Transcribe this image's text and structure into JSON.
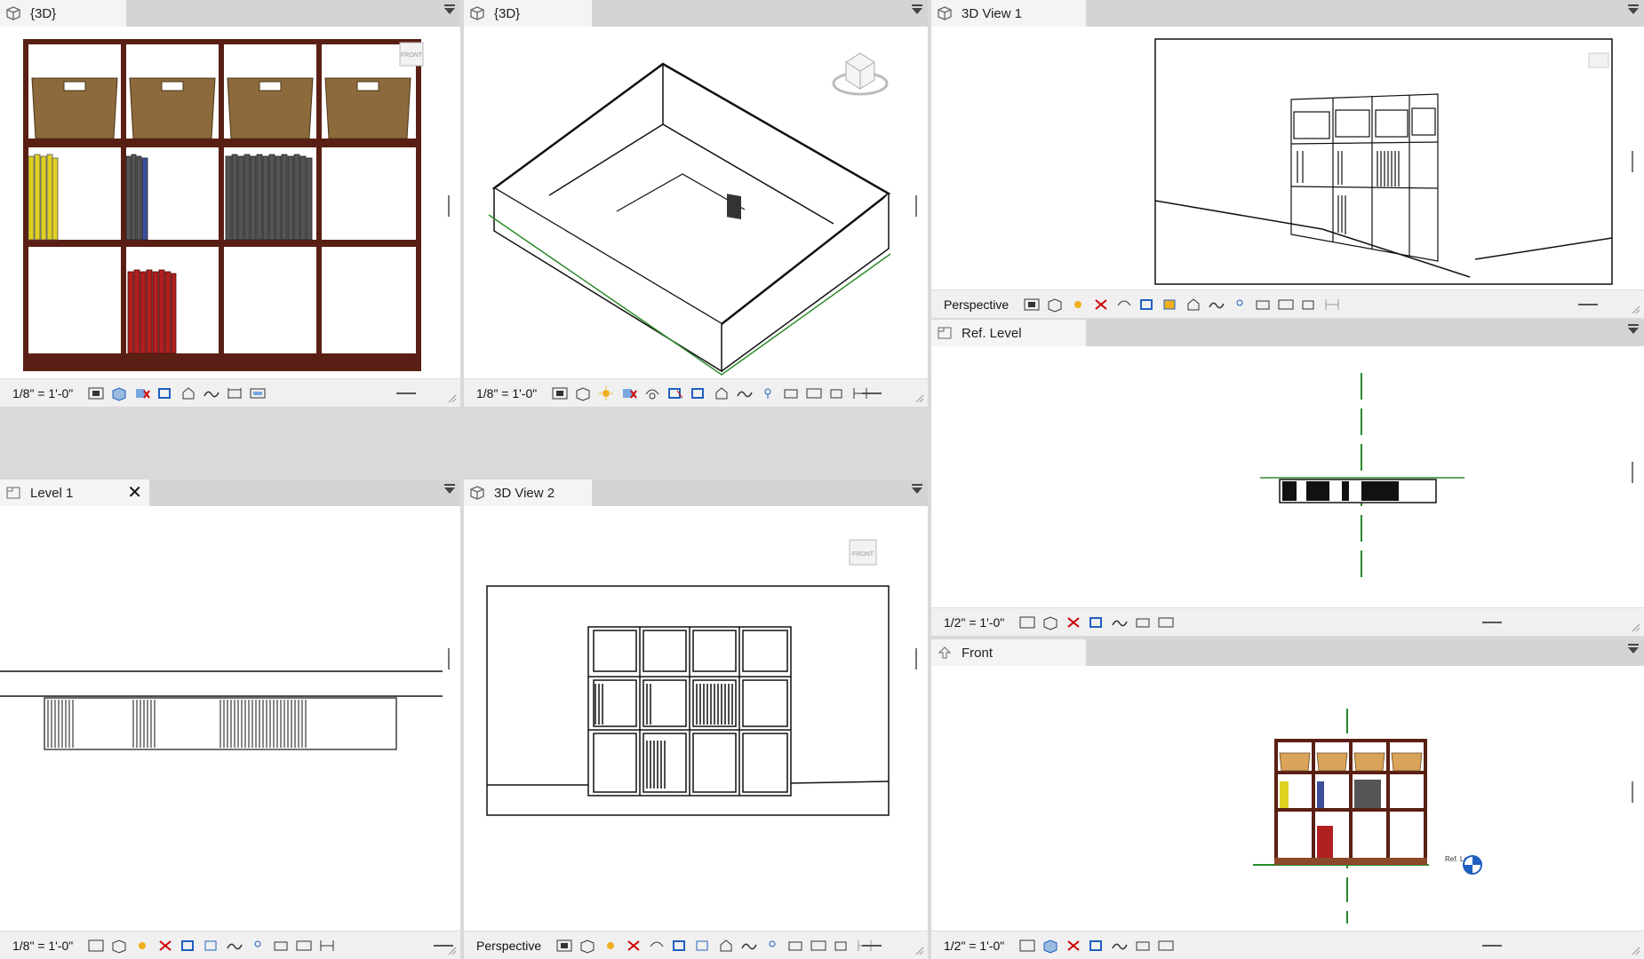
{
  "panes": {
    "tl": {
      "title": "{3D}",
      "scale": "1/8\" = 1'-0\"",
      "viewcube": "FRONT"
    },
    "tm": {
      "title": "{3D}",
      "scale": "1/8\" = 1'-0\""
    },
    "tr": {
      "title": "3D View 1",
      "scale": "Perspective"
    },
    "ref": {
      "title": "Ref. Level",
      "scale": "1/2\" = 1'-0\""
    },
    "bl": {
      "title": "Level 1",
      "scale": "1/8\" = 1'-0\"",
      "close": "✕"
    },
    "bm": {
      "title": "3D View 2",
      "scale": "Perspective",
      "viewcube": "FRONT"
    },
    "front": {
      "title": "Front",
      "scale": "1/2\" = 1'-0\"",
      "level_tag": "Ref. Level"
    }
  },
  "colors": {
    "shelf": "#5a1f14",
    "basket": "#8c6a3c",
    "yellow": "#e0d020",
    "gray": "#555555",
    "red": "#b02020",
    "green": "#2a8a2a",
    "blue": "#1f5fbf"
  },
  "icons": [
    "view-cube-icon",
    "visual-style-icon",
    "sun-path-icon",
    "shadows-icon",
    "crop-icon",
    "hide-isolate-icon",
    "reveal-icon",
    "lock-3d-icon",
    "temp-view-icon",
    "analytical-icon"
  ]
}
